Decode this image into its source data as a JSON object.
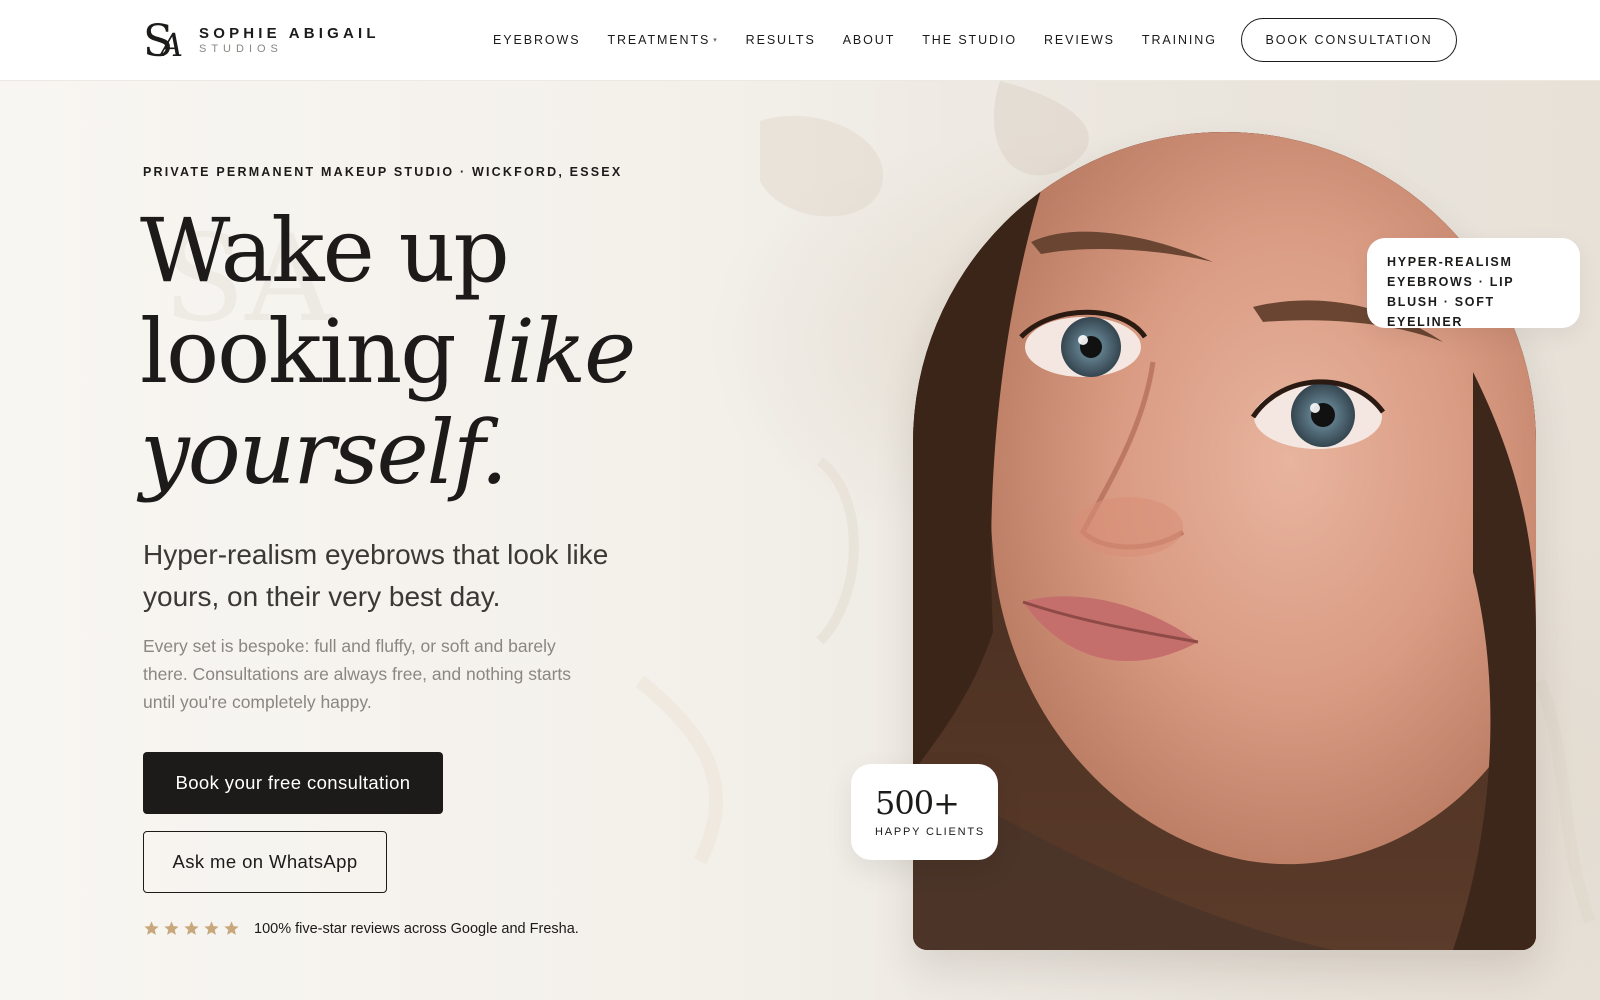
{
  "brand": {
    "name": "SOPHIE ABIGAIL",
    "sub": "STUDIOS",
    "mark_letters": "SA"
  },
  "nav": {
    "items": [
      {
        "label": "EYEBROWS",
        "caret": false
      },
      {
        "label": "TREATMENTS",
        "caret": true
      },
      {
        "label": "RESULTS",
        "caret": false
      },
      {
        "label": "ABOUT",
        "caret": false
      },
      {
        "label": "THE STUDIO",
        "caret": false
      },
      {
        "label": "REVIEWS",
        "caret": false
      },
      {
        "label": "TRAINING",
        "caret": false
      }
    ],
    "caret_glyph": "▾",
    "cta": "BOOK CONSULTATION"
  },
  "hero": {
    "eyebrow": "PRIVATE PERMANENT MAKEUP STUDIO · WICKFORD, ESSEX",
    "headline_line1": "Wake up",
    "headline_line2_plain": "looking ",
    "headline_line2_italic": "like",
    "headline_line3_italic": "yourself.",
    "subhead": "Hyper-realism eyebrows that look like yours, on their very best day.",
    "body": "Every set is bespoke: full and fluffy, or soft and barely there. Consultations are always free, and nothing starts until you're completely happy.",
    "primary_cta": "Book your free consultation",
    "secondary_cta": "Ask me on WhatsApp",
    "rating": {
      "stars": 5,
      "star_color": "#c9a77c",
      "text": "100% five-star reviews across Google and Fresha."
    }
  },
  "badges": {
    "tags": "HYPER-REALISM EYEBROWS · LIP BLUSH · SOFT EYELINER",
    "clients_number": "500+",
    "clients_label": "HAPPY CLIENTS"
  },
  "colors": {
    "ink": "#1c1b1a",
    "muted": "#8a8782",
    "accent_gold": "#c9a77c",
    "background": "#f3f0eb"
  },
  "icons": {
    "logo": "sa-monogram-icon",
    "star": "star-icon",
    "caret": "chevron-down-icon"
  }
}
